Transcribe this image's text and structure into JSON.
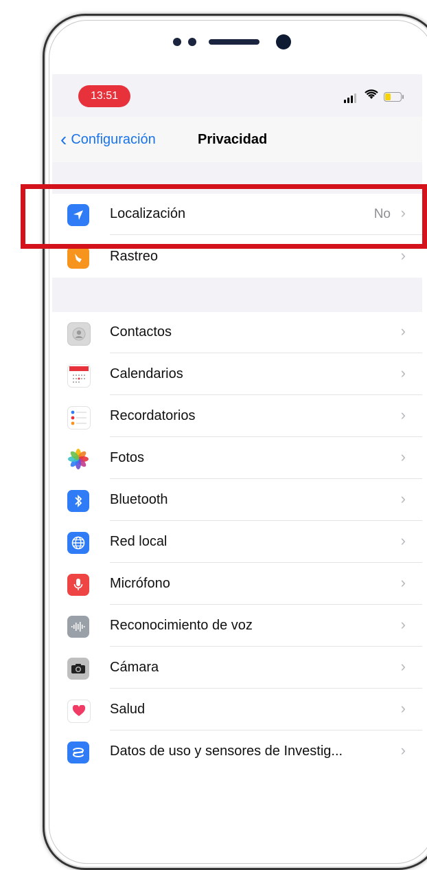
{
  "status_bar": {
    "time": "13:51"
  },
  "nav": {
    "back_label": "Configuración",
    "title": "Privacidad"
  },
  "group1": [
    {
      "label": "Localización",
      "value": "No",
      "icon": "location-arrow-icon",
      "color": "#2f7cf6"
    },
    {
      "label": "Rastreo",
      "value": "",
      "icon": "tracking-icon",
      "color": "#f7941d"
    }
  ],
  "group2": [
    {
      "label": "Contactos",
      "icon": "contacts-icon",
      "color": "#d9d9d9"
    },
    {
      "label": "Calendarios",
      "icon": "calendar-icon",
      "color": "#ffffff"
    },
    {
      "label": "Recordatorios",
      "icon": "reminders-icon",
      "color": "#ffffff"
    },
    {
      "label": "Fotos",
      "icon": "photos-icon",
      "color": "#ffffff"
    },
    {
      "label": "Bluetooth",
      "icon": "bluetooth-icon",
      "color": "#2f7cf6"
    },
    {
      "label": "Red local",
      "icon": "globe-icon",
      "color": "#2f7cf6"
    },
    {
      "label": "Micrófono",
      "icon": "microphone-icon",
      "color": "#ee4444"
    },
    {
      "label": "Reconocimiento de voz",
      "icon": "waveform-icon",
      "color": "#9aa0a8"
    },
    {
      "label": "Cámara",
      "icon": "camera-icon",
      "color": "#bfbfbf"
    },
    {
      "label": "Salud",
      "icon": "heart-icon",
      "color": "#ffffff"
    },
    {
      "label": "Datos de uso y sensores de Investig...",
      "icon": "research-icon",
      "color": "#2f7cf6"
    }
  ],
  "colors": {
    "accent": "#1a73e8",
    "highlight": "#d4121b",
    "time_pill": "#e8323b"
  }
}
